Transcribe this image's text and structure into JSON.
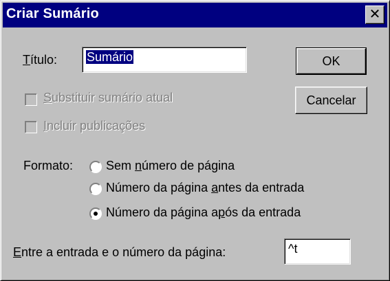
{
  "window": {
    "title": "Criar Sumário",
    "close_glyph": "✕"
  },
  "titulo": {
    "label_accel": "T",
    "label_rest": "ítulo:",
    "value": "Sumário"
  },
  "buttons": {
    "ok": "OK",
    "cancel": "Cancelar"
  },
  "checkboxes": [
    {
      "accel": "S",
      "rest": "ubstituir sumário atual",
      "checked": false,
      "enabled": false
    },
    {
      "accel": "I",
      "rest": "ncluir publicações",
      "checked": false,
      "enabled": false
    }
  ],
  "formato": {
    "label": "Formato:",
    "options": [
      {
        "before": "Sem ",
        "accel": "n",
        "after": "úmero de página",
        "selected": false
      },
      {
        "before": "Número da página ",
        "accel": "a",
        "after": "ntes da entrada",
        "selected": false
      },
      {
        "before": "Número da página a",
        "accel": "p",
        "after": "ós da entrada",
        "selected": true
      }
    ]
  },
  "separator": {
    "label_accel": "E",
    "label_rest": "ntre a entrada e o número da página:",
    "value": "^t"
  }
}
